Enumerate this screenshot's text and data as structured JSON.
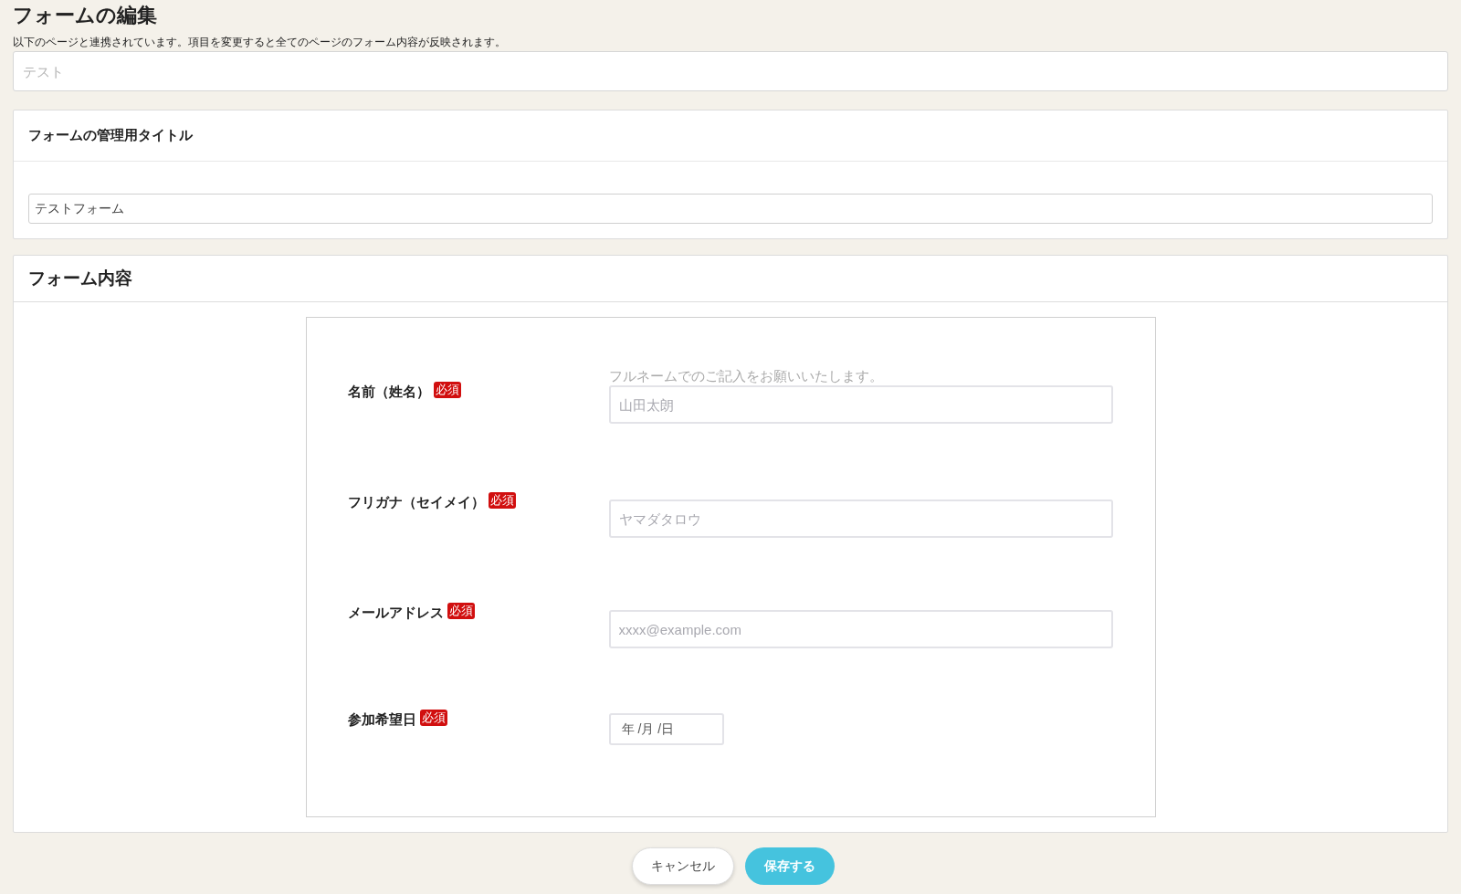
{
  "page": {
    "title": "フォームの編集",
    "description": "以下のページと連携されています。項目を変更すると全てのページのフォーム内容が反映されます。",
    "linked_pages": {
      "placeholder": "テスト"
    }
  },
  "admin_title_card": {
    "heading": "フォームの管理用タイトル",
    "field": {
      "value": "テストフォーム"
    }
  },
  "form_content_card": {
    "heading": "フォーム内容",
    "fields": [
      {
        "kind": "text",
        "label": "名前（姓名）",
        "required": true,
        "required_badge": "必須",
        "hint": "フルネームでのご記入をお願いいたします。",
        "placeholder": "山田太朗"
      },
      {
        "kind": "text",
        "label": "フリガナ（セイメイ）",
        "required": true,
        "required_badge": "必須",
        "placeholder": "ヤマダタロウ"
      },
      {
        "kind": "text",
        "label": "メールアドレス",
        "required": true,
        "required_badge": "必須",
        "placeholder": "xxxx@example.com"
      },
      {
        "kind": "date",
        "label": "参加希望日",
        "required": true,
        "required_badge": "必須",
        "date_parts": [
          "年",
          "/月",
          "/日"
        ]
      }
    ]
  },
  "buttons": [
    {
      "kind": "secondary",
      "label": "キャンセル"
    },
    {
      "kind": "primary",
      "label": "保存する"
    }
  ]
}
